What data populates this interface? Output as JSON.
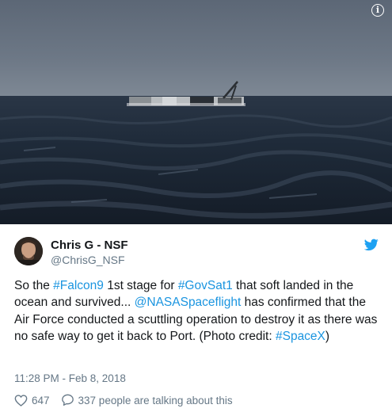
{
  "media": {
    "alt": "",
    "info_icon": "info-icon"
  },
  "author": {
    "name": "Chris G - NSF",
    "handle": "@ChrisG_NSF",
    "avatar": "avatar",
    "platform_icon": "twitter-bird-icon"
  },
  "tweet": {
    "segments": [
      {
        "type": "text",
        "value": "So the "
      },
      {
        "type": "hashtag",
        "value": "#Falcon9"
      },
      {
        "type": "text",
        "value": " 1st stage for "
      },
      {
        "type": "hashtag",
        "value": "#GovSat1"
      },
      {
        "type": "text",
        "value": " that soft landed in the ocean and survived... "
      },
      {
        "type": "mention",
        "value": "@NASASpaceflight"
      },
      {
        "type": "text",
        "value": " has confirmed that the Air Force conducted a scuttling operation to destroy it as there was no safe way to get it back to Port. (Photo credit: "
      },
      {
        "type": "hashtag",
        "value": "#SpaceX"
      },
      {
        "type": "text",
        "value": ")"
      }
    ],
    "timestamp": "11:28 PM - Feb 8, 2018"
  },
  "actions": {
    "like_count": "647",
    "talking_label": "337 people are talking about this"
  },
  "colors": {
    "link": "#1b95e0",
    "secondary": "#657786",
    "bird": "#1da1f2"
  }
}
